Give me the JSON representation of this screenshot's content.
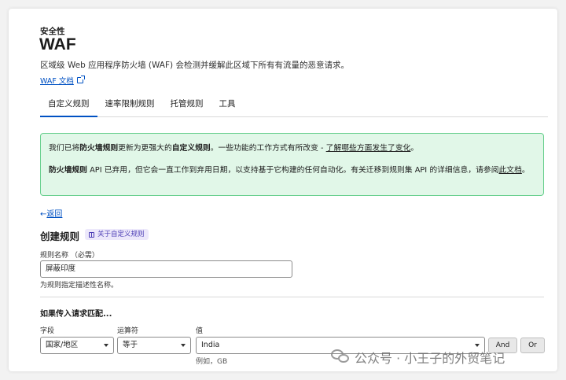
{
  "header": {
    "section": "安全性",
    "title": "WAF",
    "description": "区域级 Web 应用程序防火墙 (WAF) 会检测并缓解此区域下所有有流量的恶意请求。",
    "doc_link": "WAF 文档"
  },
  "tabs": [
    {
      "label": "自定义规则",
      "active": true
    },
    {
      "label": "速率限制规则",
      "active": false
    },
    {
      "label": "托管规则",
      "active": false
    },
    {
      "label": "工具",
      "active": false
    }
  ],
  "notice": {
    "p1_a": "我们已将",
    "p1_b": "防火墙规则",
    "p1_c": "更新为更强大的",
    "p1_d": "自定义规则",
    "p1_e": "。一些功能的工作方式有所改变 - ",
    "p1_link": "了解哪些方面发生了变化",
    "p1_f": "。",
    "p2_a": "防火墙规则",
    "p2_b": " API 已弃用，但它会一直工作到弃用日期，以支持基于它构建的任何自动化。有关迁移到规则集 API 的详细信息，请参阅",
    "p2_link": "此文档",
    "p2_c": "。"
  },
  "back": {
    "arrow": "←",
    "label": "返回"
  },
  "form": {
    "heading": "创建规则",
    "pill": "关于自定义规则",
    "name_label": "规则名称 （必需）",
    "name_value": "屏蔽印度",
    "name_hint": "为规则指定描述性名称。",
    "match_heading": "如果传入请求匹配...",
    "field_label": "字段",
    "operator_label": "运算符",
    "value_label": "值",
    "field_value": "国家/地区",
    "operator_value": "等于",
    "value_value": "India",
    "and_label": "And",
    "or_label": "Or",
    "value_hint": "例如，GB"
  },
  "watermark": {
    "text": "公众号 · 小王子的外贸笔记"
  },
  "colors": {
    "link": "#0051c3",
    "notice_bg": "#e1f7e8",
    "notice_border": "#6ad08f",
    "pill_bg": "#ece8fb"
  }
}
